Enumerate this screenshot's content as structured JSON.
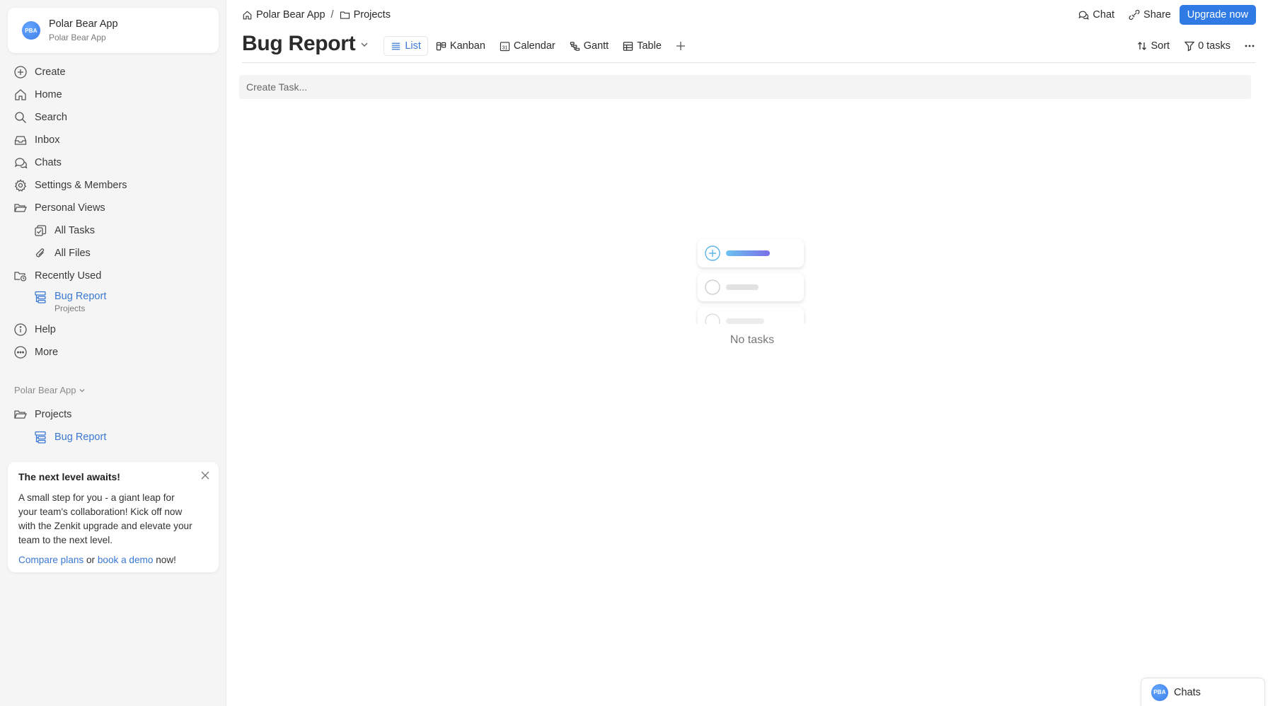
{
  "workspace": {
    "avatar_initials": "PBA",
    "name": "Polar Bear App",
    "subtitle": "Polar Bear App"
  },
  "nav": {
    "create": "Create",
    "home": "Home",
    "search": "Search",
    "inbox": "Inbox",
    "chats": "Chats",
    "settings": "Settings & Members",
    "personal_views": "Personal Views",
    "all_tasks": "All Tasks",
    "all_files": "All Files",
    "recently_used": "Recently Used",
    "recent_item": {
      "title": "Bug Report",
      "subtitle": "Projects"
    },
    "help": "Help",
    "more": "More"
  },
  "workspace_section": {
    "label": "Polar Bear App",
    "folder": "Projects",
    "collection": "Bug Report"
  },
  "promo": {
    "title": "The next level awaits!",
    "body": "A small step for you - a giant leap for your team's collaboration! Kick off now with the Zenkit upgrade and elevate your team to the next level.",
    "link1": "Compare plans",
    "or": "or",
    "link2": "book a demo",
    "end": "now!"
  },
  "breadcrumb": {
    "root": "Polar Bear App",
    "separator": "/",
    "folder": "Projects"
  },
  "top_actions": {
    "chat": "Chat",
    "share": "Share",
    "upgrade": "Upgrade now"
  },
  "page": {
    "title": "Bug Report"
  },
  "views": {
    "list": "List",
    "kanban": "Kanban",
    "calendar": "Calendar",
    "gantt": "Gantt",
    "table": "Table",
    "active": "List"
  },
  "tools": {
    "sort": "Sort",
    "filter": "0 tasks"
  },
  "create_task": {
    "placeholder": "Create Task..."
  },
  "empty_state": {
    "text": "No tasks"
  },
  "chat_dock": {
    "avatar_initials": "PBA",
    "label": "Chats"
  },
  "colors": {
    "accent": "#2f7ae5",
    "link": "#3a78d3",
    "sidebar_bg": "#f5f5f5"
  }
}
